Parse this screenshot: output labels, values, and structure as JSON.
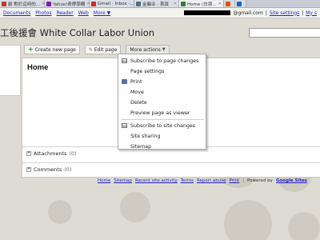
{
  "browser": {
    "tabs": [
      {
        "label": "劇 對於這時的…",
        "fav": "#c0392b",
        "active": false
      },
      {
        "label": "Yahoo!奇摩學購",
        "fav": "#7b1fa2",
        "active": false
      },
      {
        "label": "Gmail - Inbox -…",
        "fav": "#c62828",
        "active": false
      },
      {
        "label": "金屬业 - 首頁",
        "fav": "#546e7a",
        "active": false
      },
      {
        "label": "Home (白領…",
        "fav": "#2e7d32",
        "active": true
      },
      {
        "label": "",
        "fav": "#e65100",
        "active": false
      },
      {
        "label": "",
        "fav": "#1565c0",
        "active": false
      }
    ]
  },
  "gbar": {
    "links": [
      "Documents",
      "Photos",
      "Reader",
      "Web",
      "More ▼"
    ],
    "account_suffix": "@gmail.com",
    "separator": "|",
    "site_settings": "Site settings",
    "my_sites": "My s"
  },
  "site": {
    "title": "工後援會 White Collar Labor Union"
  },
  "toolbar": {
    "create_label": "Create new page",
    "edit_label": "Edit page",
    "more_label": "More actions"
  },
  "page": {
    "heading": "Home",
    "attachments_label": "Attachments",
    "attachments_count": "(0)",
    "comments_label": "Comments",
    "comments_count": "(0)"
  },
  "menu": {
    "items": [
      "Subscribe to page changes",
      "Page settings",
      "Print",
      "Move",
      "Delete",
      "Preview page as viewer",
      "Subscribe to site changes",
      "Site sharing",
      "Sitemap"
    ]
  },
  "footer": {
    "links": [
      "Home",
      "Sitemap",
      "Recent site activity",
      "Terms",
      "Report abuse",
      "Print"
    ],
    "powered_text": "Powered by",
    "powered_brand": "Google Sites"
  }
}
